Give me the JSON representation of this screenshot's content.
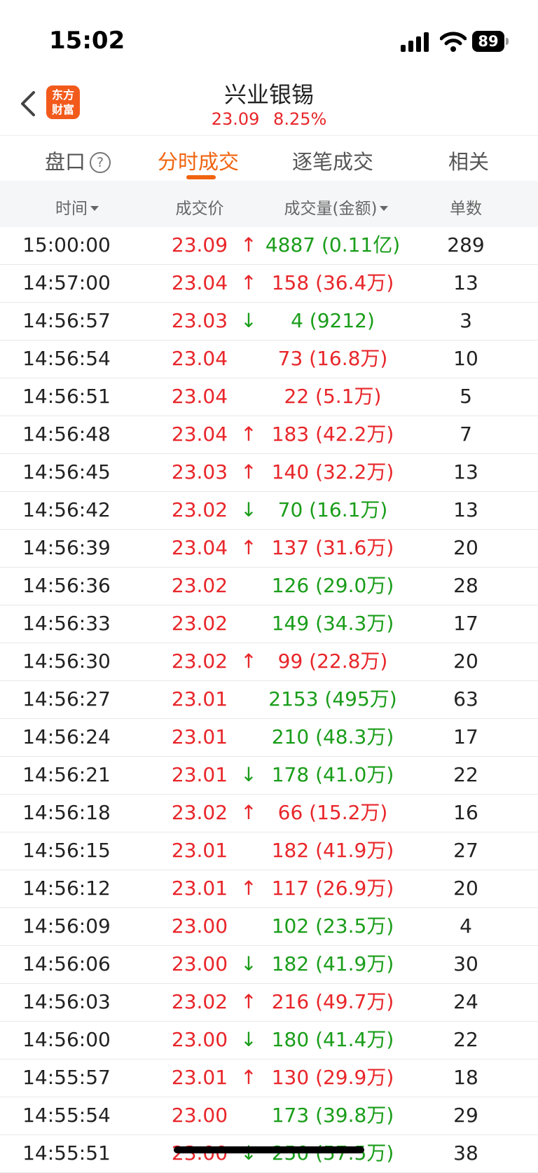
{
  "status_bar": {
    "time": "15:02",
    "battery": "89"
  },
  "header": {
    "logo_line1": "东方",
    "logo_line2": "财富",
    "title": "兴业银锡",
    "price": "23.09",
    "change_pct": "8.25%"
  },
  "tabs": [
    {
      "label": "盘口",
      "active": false
    },
    {
      "label": "分时成交",
      "active": true
    },
    {
      "label": "逐笔成交",
      "active": false
    },
    {
      "label": "相关",
      "active": false
    }
  ],
  "columns": {
    "time": "时间",
    "price": "成交价",
    "volume": "成交量(金额)",
    "count": "单数"
  },
  "colors": {
    "up": "#e8262a",
    "down": "#1a9d1a",
    "accent": "#f0640f"
  },
  "trades": [
    {
      "time": "15:00:00",
      "price": "23.09",
      "arrow": "up",
      "volume": "4887 (0.11亿)",
      "vol_color": "green",
      "count": "289"
    },
    {
      "time": "14:57:00",
      "price": "23.04",
      "arrow": "up",
      "volume": "158 (36.4万)",
      "vol_color": "red",
      "count": "13"
    },
    {
      "time": "14:56:57",
      "price": "23.03",
      "arrow": "down",
      "volume": "4 (9212)",
      "vol_color": "green",
      "count": "3"
    },
    {
      "time": "14:56:54",
      "price": "23.04",
      "arrow": "",
      "volume": "73 (16.8万)",
      "vol_color": "red",
      "count": "10"
    },
    {
      "time": "14:56:51",
      "price": "23.04",
      "arrow": "",
      "volume": "22 (5.1万)",
      "vol_color": "red",
      "count": "5"
    },
    {
      "time": "14:56:48",
      "price": "23.04",
      "arrow": "up",
      "volume": "183 (42.2万)",
      "vol_color": "red",
      "count": "7"
    },
    {
      "time": "14:56:45",
      "price": "23.03",
      "arrow": "up",
      "volume": "140 (32.2万)",
      "vol_color": "red",
      "count": "13"
    },
    {
      "time": "14:56:42",
      "price": "23.02",
      "arrow": "down",
      "volume": "70 (16.1万)",
      "vol_color": "green",
      "count": "13"
    },
    {
      "time": "14:56:39",
      "price": "23.04",
      "arrow": "up",
      "volume": "137 (31.6万)",
      "vol_color": "red",
      "count": "20"
    },
    {
      "time": "14:56:36",
      "price": "23.02",
      "arrow": "",
      "volume": "126 (29.0万)",
      "vol_color": "green",
      "count": "28"
    },
    {
      "time": "14:56:33",
      "price": "23.02",
      "arrow": "",
      "volume": "149 (34.3万)",
      "vol_color": "green",
      "count": "17"
    },
    {
      "time": "14:56:30",
      "price": "23.02",
      "arrow": "up",
      "volume": "99 (22.8万)",
      "vol_color": "red",
      "count": "20"
    },
    {
      "time": "14:56:27",
      "price": "23.01",
      "arrow": "",
      "volume": "2153 (495万)",
      "vol_color": "green",
      "count": "63"
    },
    {
      "time": "14:56:24",
      "price": "23.01",
      "arrow": "",
      "volume": "210 (48.3万)",
      "vol_color": "green",
      "count": "17"
    },
    {
      "time": "14:56:21",
      "price": "23.01",
      "arrow": "down",
      "volume": "178 (41.0万)",
      "vol_color": "green",
      "count": "22"
    },
    {
      "time": "14:56:18",
      "price": "23.02",
      "arrow": "up",
      "volume": "66 (15.2万)",
      "vol_color": "red",
      "count": "16"
    },
    {
      "time": "14:56:15",
      "price": "23.01",
      "arrow": "",
      "volume": "182 (41.9万)",
      "vol_color": "red",
      "count": "27"
    },
    {
      "time": "14:56:12",
      "price": "23.01",
      "arrow": "up",
      "volume": "117 (26.9万)",
      "vol_color": "red",
      "count": "20"
    },
    {
      "time": "14:56:09",
      "price": "23.00",
      "arrow": "",
      "volume": "102 (23.5万)",
      "vol_color": "green",
      "count": "4"
    },
    {
      "time": "14:56:06",
      "price": "23.00",
      "arrow": "down",
      "volume": "182 (41.9万)",
      "vol_color": "green",
      "count": "30"
    },
    {
      "time": "14:56:03",
      "price": "23.02",
      "arrow": "up",
      "volume": "216 (49.7万)",
      "vol_color": "red",
      "count": "24"
    },
    {
      "time": "14:56:00",
      "price": "23.00",
      "arrow": "down",
      "volume": "180 (41.4万)",
      "vol_color": "green",
      "count": "22"
    },
    {
      "time": "14:55:57",
      "price": "23.01",
      "arrow": "up",
      "volume": "130 (29.9万)",
      "vol_color": "red",
      "count": "18"
    },
    {
      "time": "14:55:54",
      "price": "23.00",
      "arrow": "",
      "volume": "173 (39.8万)",
      "vol_color": "green",
      "count": "29"
    },
    {
      "time": "14:55:51",
      "price": "23.00",
      "arrow": "down",
      "volume": "250 (57.5万)",
      "vol_color": "green",
      "count": "38"
    }
  ]
}
